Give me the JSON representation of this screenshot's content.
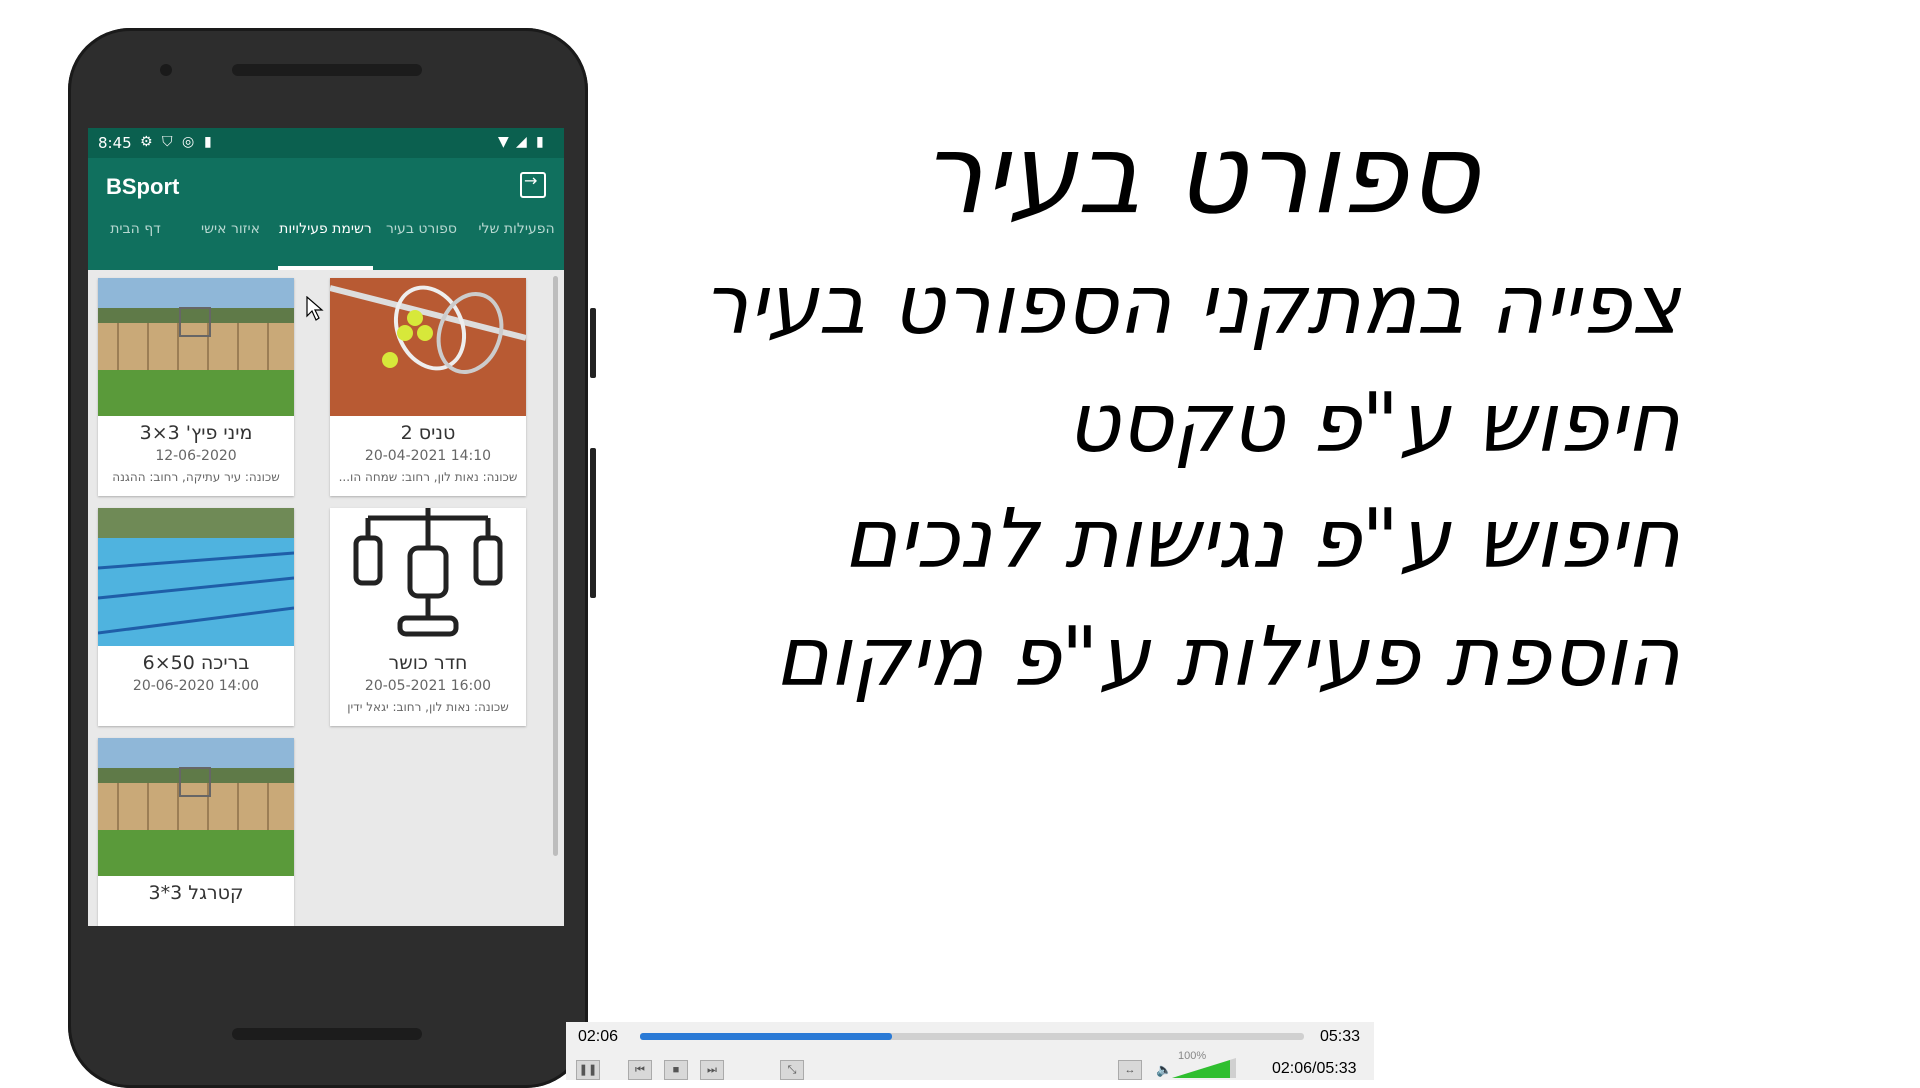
{
  "phone": {
    "status": {
      "time": "8:45"
    },
    "app_title": "BSport",
    "tabs": [
      {
        "label": "הפעילות שלי"
      },
      {
        "label": "ספורט בעיר"
      },
      {
        "label": "רשימת פעילויות"
      },
      {
        "label": "איזור אישי"
      },
      {
        "label": "דף הבית"
      }
    ],
    "cards": [
      {
        "name": "מיני פיץ' 3×3",
        "date": "12-06-2020",
        "address": "שכונה: עיר עתיקה, רחוב: ההגנה",
        "image": "basketball-court"
      },
      {
        "name": "טניס 2",
        "date": "20-04-2021 14:10",
        "address": "שכונה: נאות לון, רחוב: שמחה הו...",
        "image": "tennis"
      },
      {
        "name": "בריכה 50×6",
        "date": "20-06-2020 14:00",
        "address": "",
        "image": "pool"
      },
      {
        "name": "חדר כושר",
        "date": "20-05-2021 16:00",
        "address": "שכונה: נאות לון, רחוב: יגאל ידין",
        "image": "gym-icon"
      },
      {
        "name": "קטרגל 3*3",
        "date": "",
        "address": "",
        "image": "basketball-court"
      }
    ]
  },
  "slide": {
    "title": "ספורט בעיר",
    "lines": [
      "צפייה במתקני הספורט בעיר",
      "חיפוש ע\"פ טקסט",
      "חיפוש ע\"פ נגישות לנכים",
      "הוספת פעילות ע\"פ מיקום"
    ]
  },
  "player": {
    "elapsed": "02:06",
    "total": "05:33",
    "position_text": "02:06/05:33",
    "progress": 0.38,
    "volume": "100%",
    "colors": {
      "progress": "#2a7ad6",
      "app_primary": "#10705e"
    }
  }
}
